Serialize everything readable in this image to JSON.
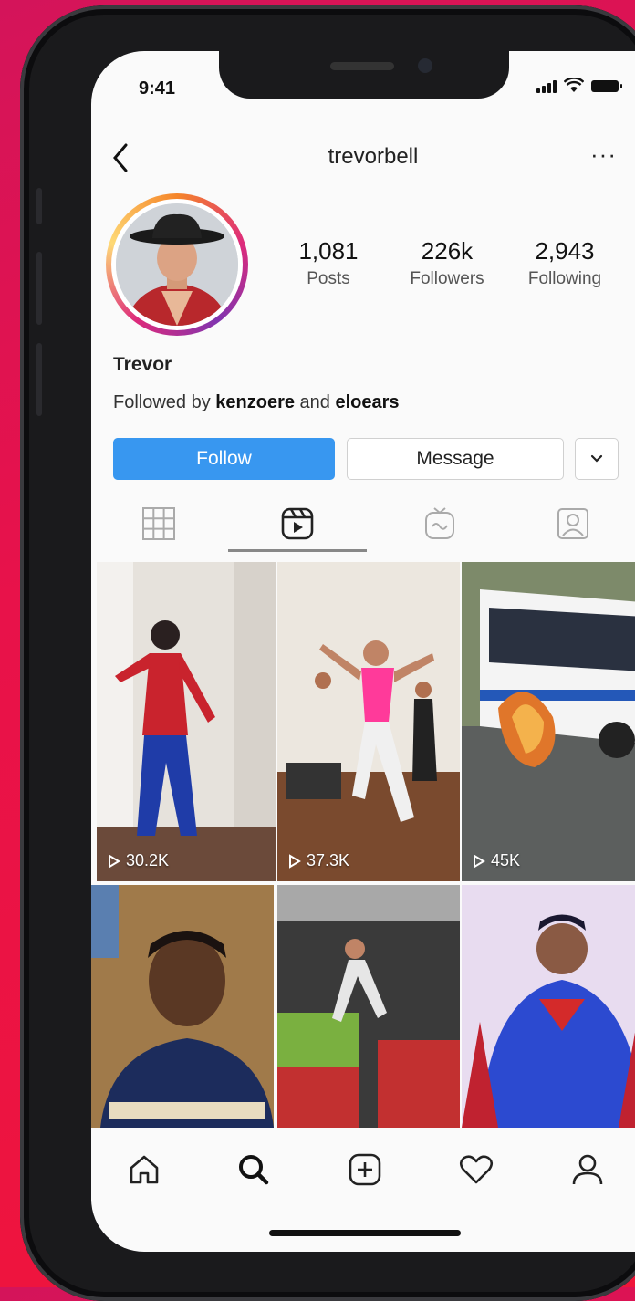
{
  "status": {
    "time": "9:41"
  },
  "profile": {
    "username": "trevorbell",
    "name": "Trevor",
    "stats": [
      {
        "value": "1,081",
        "label": "Posts"
      },
      {
        "value": "226k",
        "label": "Followers"
      },
      {
        "value": "2,943",
        "label": "Following"
      }
    ],
    "followed_by_prefix": "Followed by ",
    "followed_by_user1": "kenzoere",
    "followed_by_and": " and ",
    "followed_by_user2": "eloears"
  },
  "actions": {
    "follow_label": "Follow",
    "message_label": "Message"
  },
  "tabs": [
    "grid",
    "reels",
    "igtv",
    "tagged"
  ],
  "grid_items": [
    {
      "views": "30.2K"
    },
    {
      "views": "37.3K"
    },
    {
      "views": "45K"
    },
    {
      "views": ""
    },
    {
      "views": ""
    },
    {
      "views": ""
    }
  ],
  "colors": {
    "follow_button": "#3897f0",
    "background_gradient_start": "#d4145a",
    "background_gradient_end": "#f0153a"
  },
  "bottom_nav": [
    "home-icon",
    "search-icon",
    "new-post-icon",
    "activity-heart-icon",
    "profile-icon"
  ]
}
